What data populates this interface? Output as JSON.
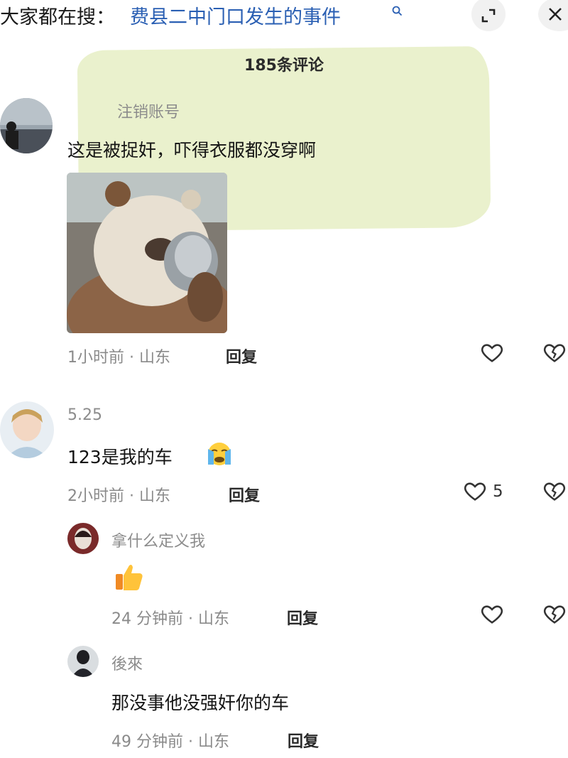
{
  "search": {
    "prefix": "大家都在搜：",
    "query": "费县二中门口发生的事件"
  },
  "header": {
    "comment_count": "185条评论"
  },
  "comments": [
    {
      "username": "注销账号",
      "text": "这是被捉奸，吓得衣服都没穿啊",
      "meta": "1小时前 · 山东",
      "reply_label": "回复"
    },
    {
      "username": "5.25",
      "text": "123是我的车",
      "meta": "2小时前 · 山东",
      "reply_label": "回复",
      "likes": "5"
    }
  ],
  "replies": [
    {
      "username": "拿什么定义我",
      "meta": "24 分钟前 · 山东",
      "reply_label": "回复"
    },
    {
      "username": "後來",
      "text": "那没事他没强奸你的车",
      "meta": "49 分钟前 · 山东",
      "reply_label": "回复"
    }
  ],
  "colors": {
    "accent_link": "#2a5fb3",
    "highlight": "#e6efc4",
    "meta_gray": "#8a8a8a"
  },
  "icons": [
    "search-icon",
    "expand-icon",
    "close-icon",
    "heart-icon",
    "broken-heart-icon",
    "crying-emoji-icon",
    "thumbs-up-emoji-icon"
  ]
}
